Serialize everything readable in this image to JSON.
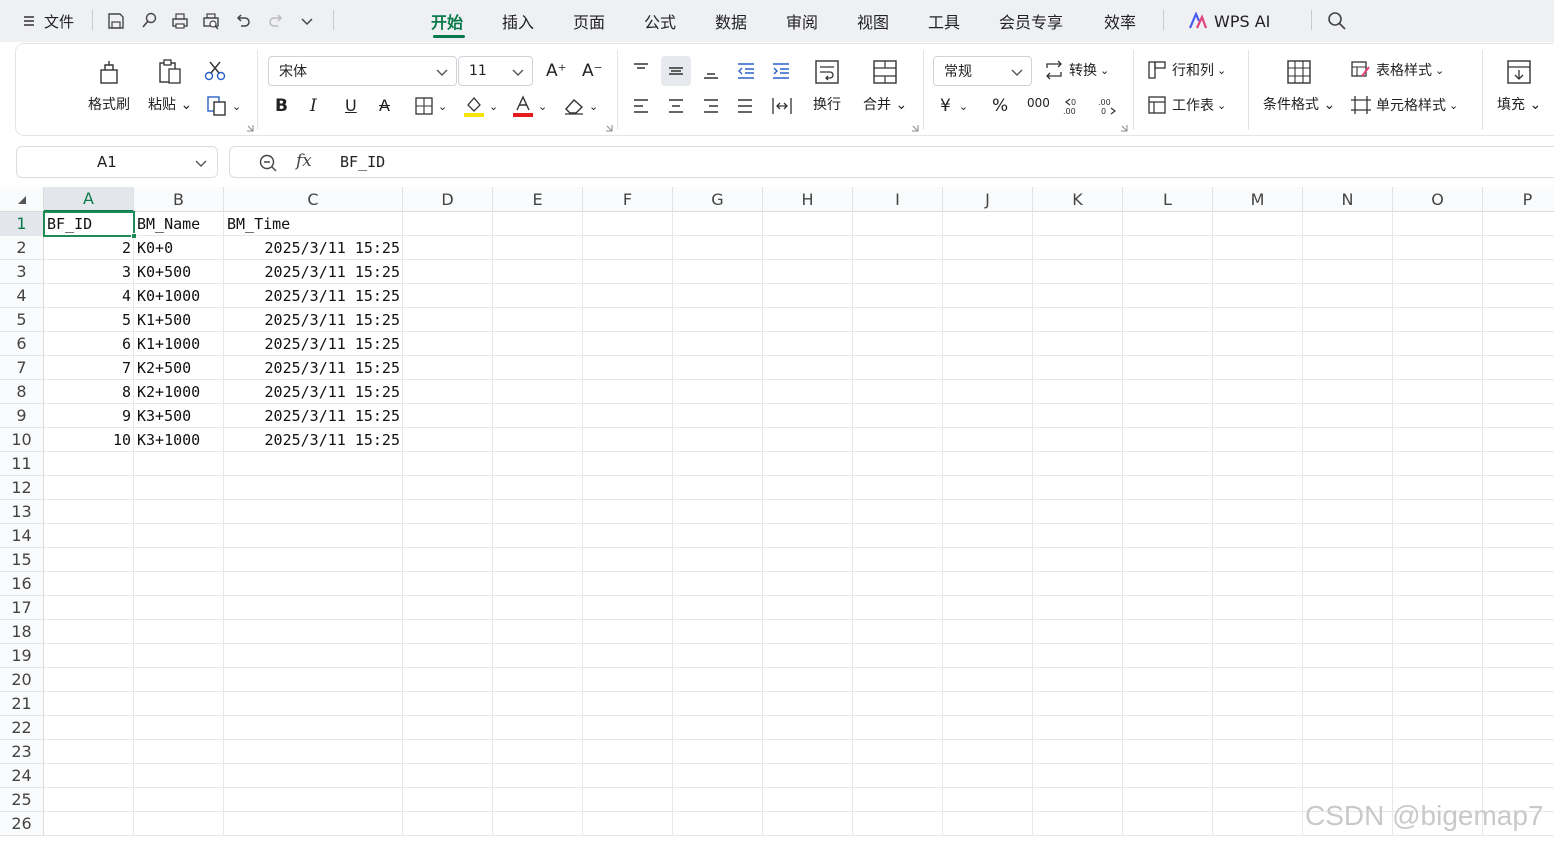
{
  "menubar": {
    "file_label": "文件",
    "tabs": [
      "开始",
      "插入",
      "页面",
      "公式",
      "数据",
      "审阅",
      "视图",
      "工具",
      "会员专享",
      "效率"
    ],
    "active_tab": "开始",
    "ai_label": "WPS AI",
    "icons": [
      "menu-icon",
      "save-icon",
      "format-painter-icon",
      "print-icon",
      "print-preview-icon",
      "undo-icon",
      "redo-icon",
      "quick-access-dropdown-icon",
      "search-icon"
    ],
    "accent_color": "#0a7a4a"
  },
  "ribbon": {
    "clipboard": {
      "format_painter": "格式刷",
      "paste": "粘贴"
    },
    "font": {
      "name": "宋体",
      "size": "11"
    },
    "alignment": {
      "wrap": "换行",
      "merge": "合并"
    },
    "number": {
      "format": "常规",
      "convert": "转换",
      "currency_symbol": "¥",
      "percent_symbol": "%",
      "thousands_symbol": "000"
    },
    "cells": {
      "row_col": "行和列",
      "worksheet": "工作表"
    },
    "styles": {
      "conditional": "条件格式",
      "table_style": "表格样式",
      "cell_style": "单元格样式"
    },
    "editing": {
      "fill": "填充"
    }
  },
  "formula_bar": {
    "name_box": "A1",
    "fx_label": "fx",
    "content": "BF_ID"
  },
  "sheet": {
    "columns": [
      "A",
      "B",
      "C",
      "D",
      "E",
      "F",
      "G",
      "H",
      "I",
      "J",
      "K",
      "L",
      "M",
      "N",
      "O",
      "P"
    ],
    "rows": [
      "1",
      "2",
      "3",
      "4",
      "5",
      "6",
      "7",
      "8",
      "9",
      "10",
      "11",
      "12",
      "13",
      "14",
      "15",
      "16",
      "17",
      "18",
      "19",
      "20",
      "21",
      "22",
      "23",
      "24",
      "25",
      "26"
    ],
    "selected_cell": "A1",
    "header": [
      "BF_ID",
      "BM_Name",
      "BM_Time"
    ],
    "data": [
      [
        "2",
        "K0+0",
        "2025/3/11 15:25"
      ],
      [
        "3",
        "K0+500",
        "2025/3/11 15:25"
      ],
      [
        "4",
        "K0+1000",
        "2025/3/11 15:25"
      ],
      [
        "5",
        "K1+500",
        "2025/3/11 15:25"
      ],
      [
        "6",
        "K1+1000",
        "2025/3/11 15:25"
      ],
      [
        "7",
        "K2+500",
        "2025/3/11 15:25"
      ],
      [
        "8",
        "K2+1000",
        "2025/3/11 15:25"
      ],
      [
        "9",
        "K3+500",
        "2025/3/11 15:25"
      ],
      [
        "10",
        "K3+1000",
        "2025/3/11 15:25"
      ]
    ]
  },
  "watermark": "CSDN @bigemap7"
}
